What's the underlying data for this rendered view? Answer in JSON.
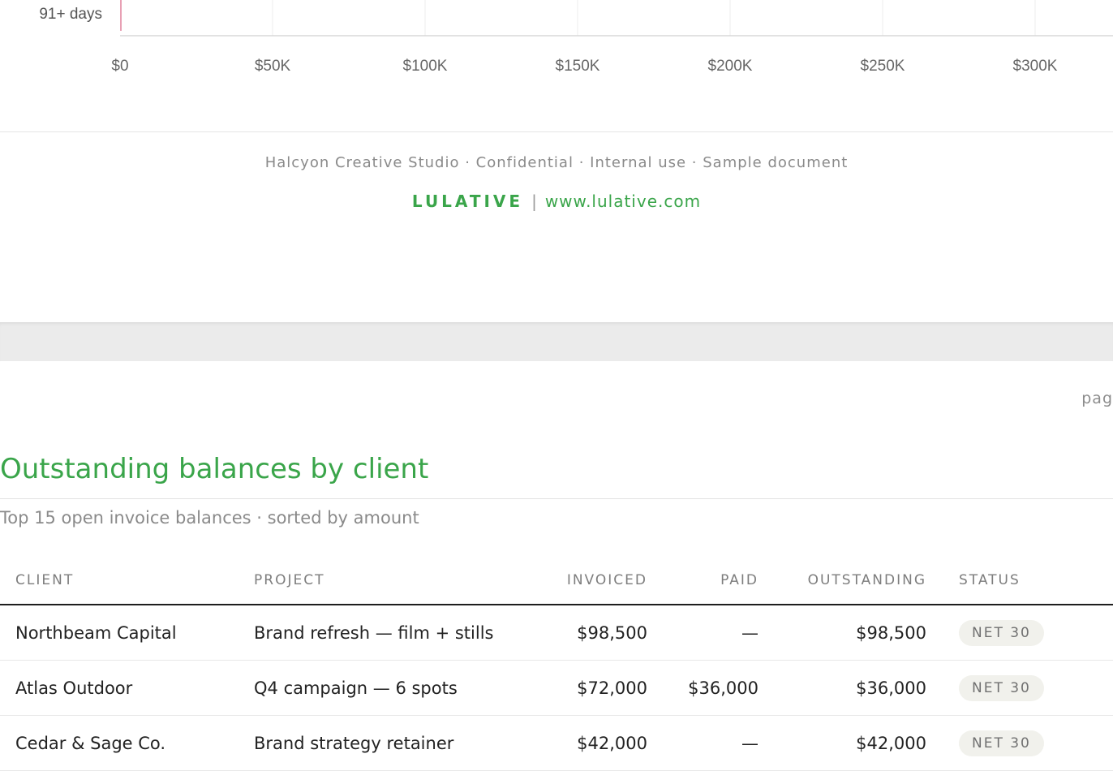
{
  "chart_data": {
    "type": "bar",
    "orientation": "horizontal",
    "categories": [
      "91+ days"
    ],
    "values": [
      0
    ],
    "xlim": [
      0,
      300000
    ],
    "xticks": [
      0,
      50000,
      100000,
      150000,
      200000,
      250000,
      300000
    ],
    "xtick_labels": [
      "$0",
      "$50K",
      "$100K",
      "$150K",
      "$200K",
      "$250K",
      "$300K"
    ],
    "grid": true,
    "colors": {
      "bar": "#e8a0b4",
      "grid": "#ececec",
      "axis": "#d8d8d8"
    }
  },
  "footer": {
    "note": "Halcyon Creative Studio · Confidential · Internal use · Sample document",
    "brand_name": "LULATIVE",
    "separator": "|",
    "url": "www.lulative.com"
  },
  "page_indicator": "pag",
  "section": {
    "title": "Outstanding balances by client",
    "subtitle": "Top 15 open invoice balances · sorted by amount"
  },
  "table": {
    "headers": {
      "client": "CLIENT",
      "project": "PROJECT",
      "invoiced": "INVOICED",
      "paid": "PAID",
      "outstanding": "OUTSTANDING",
      "status": "STATUS"
    },
    "rows": [
      {
        "client": "Northbeam Capital",
        "project": "Brand refresh — film + stills",
        "invoiced": "$98,500",
        "paid": "—",
        "outstanding": "$98,500",
        "status": "NET 30"
      },
      {
        "client": "Atlas Outdoor",
        "project": "Q4 campaign — 6 spots",
        "invoiced": "$72,000",
        "paid": "$36,000",
        "outstanding": "$36,000",
        "status": "NET 30"
      },
      {
        "client": "Cedar & Sage Co.",
        "project": "Brand strategy retainer",
        "invoiced": "$42,000",
        "paid": "—",
        "outstanding": "$42,000",
        "status": "NET 30"
      }
    ]
  },
  "colors": {
    "accent_green": "#3aa54a",
    "badge_bg": "#f1f1ec"
  }
}
